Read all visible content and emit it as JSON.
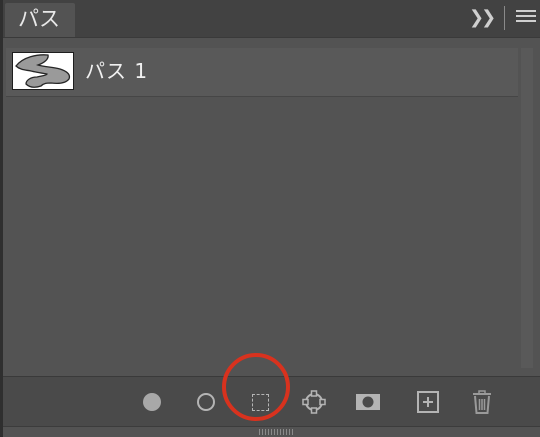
{
  "tab": {
    "title": "パス"
  },
  "paths": [
    {
      "name": "パス 1",
      "icon": "path-thumbnail"
    }
  ],
  "toolbar": {
    "tools": [
      {
        "name": "fill-path-icon"
      },
      {
        "name": "stroke-path-icon"
      },
      {
        "name": "load-as-selection-icon",
        "highlighted": true
      },
      {
        "name": "make-work-path-icon"
      },
      {
        "name": "add-mask-icon"
      },
      {
        "name": "new-path-icon"
      },
      {
        "name": "delete-path-icon"
      }
    ]
  },
  "colors": {
    "panel_bg": "#535353",
    "tab_bar": "#424242",
    "highlight_circle": "#d8321e"
  }
}
